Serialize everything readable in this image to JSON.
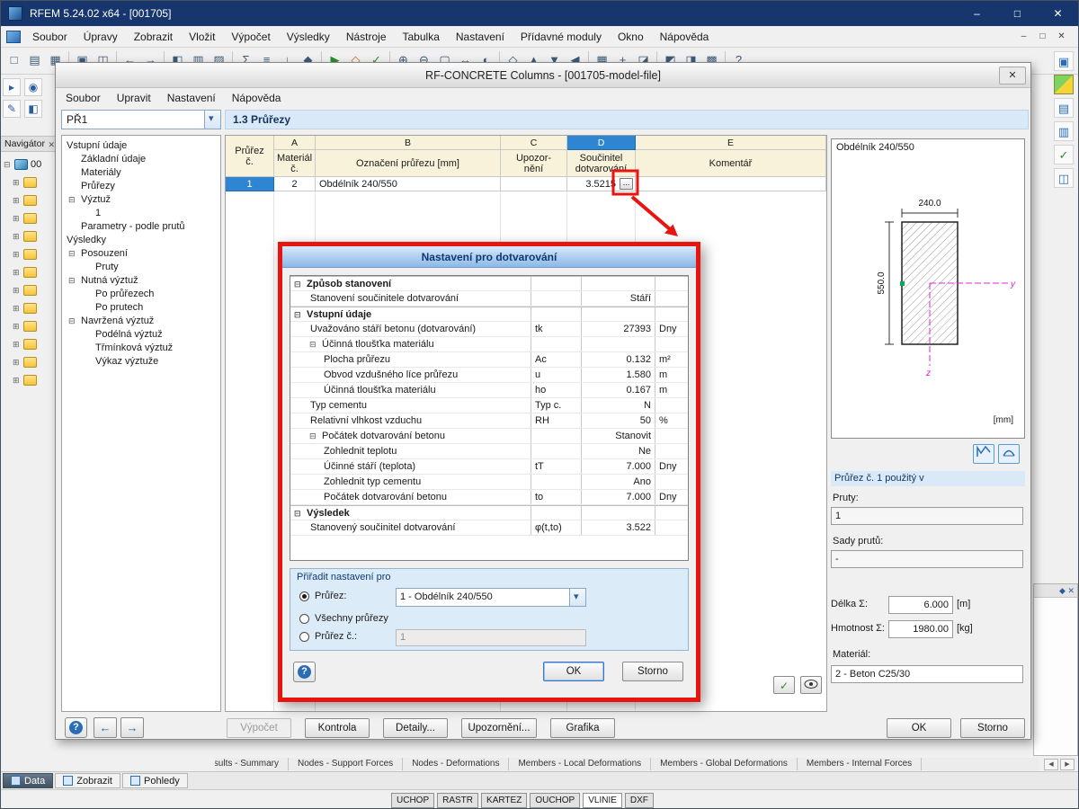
{
  "colors": {
    "accent_blue": "#2e86d2",
    "annotation_red": "#e81410",
    "titlebar_blue": "#17366e",
    "header_yellow": "#f8f2da",
    "panel_blue": "#d9e9f7"
  },
  "window": {
    "title": "RFEM 5.24.02 x64 - [001705]",
    "controls": {
      "minimize": "–",
      "maximize": "□",
      "close": "✕"
    },
    "mdi_controls": {
      "minimize": "–",
      "restore": "□",
      "close": "✕"
    },
    "menu": [
      {
        "label": "Soubor"
      },
      {
        "label": "Úpravy"
      },
      {
        "label": "Zobrazit"
      },
      {
        "label": "Vložit"
      },
      {
        "label": "Výpočet"
      },
      {
        "label": "Výsledky"
      },
      {
        "label": "Nástroje"
      },
      {
        "label": "Tabulka"
      },
      {
        "label": "Nastavení"
      },
      {
        "label": "Přídavné moduly"
      },
      {
        "label": "Okno"
      },
      {
        "label": "Nápověda"
      }
    ]
  },
  "toolbar": {
    "icons": [
      {
        "name": "new",
        "glyph": "□"
      },
      {
        "name": "open",
        "glyph": "▤"
      },
      {
        "name": "save",
        "glyph": "▦"
      },
      {
        "type": "sep"
      },
      {
        "name": "print",
        "glyph": "▣"
      },
      {
        "name": "print-preview",
        "glyph": "◫"
      },
      {
        "type": "sep"
      },
      {
        "name": "undo",
        "glyph": "←"
      },
      {
        "name": "redo",
        "glyph": "→"
      },
      {
        "type": "sep"
      },
      {
        "name": "navigator",
        "glyph": "◧"
      },
      {
        "name": "tables",
        "glyph": "▥"
      },
      {
        "name": "worksheet",
        "glyph": "▨"
      },
      {
        "type": "sep"
      },
      {
        "name": "load-cases",
        "glyph": "Σ"
      },
      {
        "name": "combinations",
        "glyph": "≡"
      },
      {
        "name": "loads",
        "glyph": "↓"
      },
      {
        "name": "imperfections",
        "glyph": "◆"
      },
      {
        "type": "sep"
      },
      {
        "name": "calculate",
        "glyph": "▶",
        "icon": "green"
      },
      {
        "name": "results",
        "glyph": "◇",
        "icon": "orange"
      },
      {
        "name": "check",
        "glyph": "✓",
        "icon": "green"
      },
      {
        "type": "sep"
      },
      {
        "name": "zoom-in",
        "glyph": "⊕"
      },
      {
        "name": "zoom-out",
        "glyph": "⊖"
      },
      {
        "name": "zoom-window",
        "glyph": "▢"
      },
      {
        "name": "pan",
        "glyph": "↔"
      },
      {
        "name": "orbit",
        "glyph": "◐"
      },
      {
        "type": "sep"
      },
      {
        "name": "view-iso",
        "glyph": "◇"
      },
      {
        "name": "view-x",
        "glyph": "▲"
      },
      {
        "name": "view-y",
        "glyph": "▼"
      },
      {
        "name": "view-z",
        "glyph": "◀"
      },
      {
        "type": "sep"
      },
      {
        "name": "grid",
        "glyph": "▦"
      },
      {
        "name": "snap",
        "glyph": "+"
      },
      {
        "name": "work-plane",
        "glyph": "◪"
      },
      {
        "type": "sep"
      },
      {
        "name": "render",
        "glyph": "◩"
      },
      {
        "name": "display",
        "glyph": "◨"
      },
      {
        "name": "modules",
        "glyph": "▩"
      },
      {
        "type": "sep"
      },
      {
        "name": "help",
        "glyph": "?"
      }
    ]
  },
  "right_toolbar": {
    "icons": [
      {
        "name": "print-view",
        "glyph": "▣"
      },
      {
        "name": "export-excel",
        "glyph": "",
        "icon": "colorgrid"
      },
      {
        "name": "input-tables",
        "glyph": "▤"
      },
      {
        "name": "result-tables",
        "glyph": "▥"
      },
      {
        "name": "check-model",
        "glyph": "✓",
        "icon": "green"
      },
      {
        "name": "panel-toggle",
        "glyph": "◫"
      }
    ]
  },
  "side_icons": [
    {
      "name": "select",
      "glyph": "▸"
    },
    {
      "name": "point",
      "glyph": "◉"
    },
    {
      "name": "edit",
      "glyph": "✎"
    },
    {
      "name": "views",
      "glyph": "◧"
    }
  ],
  "navigator": {
    "title": "Navigátor",
    "close": "✕",
    "tree": [
      {
        "box": "⊟",
        "icon": "model",
        "label": "00",
        "level": 0
      },
      {
        "box": "⊞",
        "icon": "folder",
        "label": "",
        "level": 1
      },
      {
        "box": "⊞",
        "icon": "folder",
        "label": "",
        "level": 1
      },
      {
        "box": "⊞",
        "icon": "folder",
        "label": "",
        "level": 1
      },
      {
        "box": "⊞",
        "icon": "folder",
        "label": "",
        "level": 1
      },
      {
        "box": "⊞",
        "icon": "folder",
        "label": "",
        "level": 1
      },
      {
        "box": "⊞",
        "icon": "folder",
        "label": "",
        "level": 1
      },
      {
        "box": "⊞",
        "icon": "folder",
        "label": "",
        "level": 1
      },
      {
        "box": "⊞",
        "icon": "folder",
        "label": "",
        "level": 1
      },
      {
        "box": "⊞",
        "icon": "folder",
        "label": "",
        "level": 1
      },
      {
        "box": "⊞",
        "icon": "folder",
        "label": "",
        "level": 1
      },
      {
        "box": "⊞",
        "icon": "folder",
        "label": "",
        "level": 1
      },
      {
        "box": "⊞",
        "icon": "folder",
        "label": "",
        "level": 1
      }
    ]
  },
  "module": {
    "title": "RF-CONCRETE Columns - [001705-model-file]",
    "close": "✕",
    "menu": [
      {
        "label": "Soubor"
      },
      {
        "label": "Upravit"
      },
      {
        "label": "Nastavení"
      },
      {
        "label": "Nápověda"
      }
    ],
    "case": "PŘ1",
    "section_title": "1.3 Průřezy",
    "tree": [
      {
        "label": "Vstupní údaje",
        "level": 0,
        "box": ""
      },
      {
        "label": "Základní údaje",
        "level": 1,
        "box": ""
      },
      {
        "label": "Materiály",
        "level": 1,
        "box": ""
      },
      {
        "label": "Průřezy",
        "level": 1,
        "box": ""
      },
      {
        "label": "Výztuž",
        "level": 1,
        "box": "⊟"
      },
      {
        "label": "1",
        "level": 2,
        "box": ""
      },
      {
        "label": "Parametry - podle prutů",
        "level": 1,
        "box": ""
      },
      {
        "label": "Výsledky",
        "level": 0,
        "box": ""
      },
      {
        "label": "Posouzení",
        "level": 1,
        "box": "⊟"
      },
      {
        "label": "Pruty",
        "level": 2,
        "box": ""
      },
      {
        "label": "Nutná výztuž",
        "level": 1,
        "box": "⊟"
      },
      {
        "label": "Po průřezech",
        "level": 2,
        "box": ""
      },
      {
        "label": "Po prutech",
        "level": 2,
        "box": ""
      },
      {
        "label": "Navržená výztuž",
        "level": 1,
        "box": "⊟"
      },
      {
        "label": "Podélná výztuž",
        "level": 2,
        "box": ""
      },
      {
        "label": "Třmínková výztuž",
        "level": 2,
        "box": ""
      },
      {
        "label": "Výkaz výztuže",
        "level": 2,
        "box": ""
      }
    ],
    "table": {
      "letters": [
        "A",
        "B",
        "C",
        "D",
        "E"
      ],
      "headers": {
        "rownum1": "Průřez",
        "rownum2": "č.",
        "a1": "Materiál",
        "a2": "č.",
        "b": "Označení průřezu [mm]",
        "c1": "Upozor-",
        "c2": "nění",
        "d1": "Součinitel",
        "d2": "dotvarování",
        "e": "Komentář"
      },
      "row": {
        "num": "1",
        "mat": "2",
        "name": "Obdélník 240/550",
        "warn": "",
        "creep": "3.5215",
        "more": "...",
        "comment": ""
      }
    },
    "preview": {
      "caption": "Obdélník 240/550",
      "dim_w": "240.0",
      "dim_h": "550.0",
      "axis_y": "y",
      "axis_z": "z",
      "unit": "[mm]"
    },
    "usage": {
      "title": "Průřez č. 1 použitý v",
      "pruty_label": "Pruty:",
      "pruty": "1",
      "sady_label": "Sady prutů:",
      "sady": "-",
      "delka_label": "Délka Σ:",
      "delka": "6.000",
      "delka_unit": "[m]",
      "hmotnost_label": "Hmotnost Σ:",
      "hmotnost": "1980.00",
      "hmotnost_unit": "[kg]",
      "material_label": "Materiál:",
      "material": "2 - Beton C25/30"
    },
    "buttons": {
      "vypocet": "Výpočet",
      "kontrola": "Kontrola",
      "detaily": "Detaily...",
      "upozorneni": "Upozornění...",
      "grafika": "Grafika",
      "ok": "OK",
      "storno": "Storno"
    }
  },
  "creep": {
    "title": "Nastavení pro dotvarování",
    "rows": [
      {
        "type": "section",
        "level": 0,
        "box": "⊟",
        "label": "Způsob stanovení",
        "sym": "",
        "val": "",
        "unit": ""
      },
      {
        "type": "item",
        "level": 1,
        "box": "",
        "label": "Stanovení součinitele dotvarování",
        "sym": "",
        "val": "Stáří",
        "unit": ""
      },
      {
        "type": "section",
        "level": 0,
        "box": "⊟",
        "label": "Vstupní údaje",
        "sym": "",
        "val": "",
        "unit": ""
      },
      {
        "type": "item",
        "level": 1,
        "box": "",
        "label": "Uvažováno stáří betonu (dotvarování)",
        "sym": "tk",
        "val": "27393",
        "unit": "Dny"
      },
      {
        "type": "subsection",
        "level": 1,
        "box": "⊟",
        "label": "Účinná tloušťka materiálu",
        "sym": "",
        "val": "",
        "unit": ""
      },
      {
        "type": "item",
        "level": 2,
        "box": "",
        "label": "Plocha průřezu",
        "sym": "Ac",
        "val": "0.132",
        "unit": "m²"
      },
      {
        "type": "item",
        "level": 2,
        "box": "",
        "label": "Obvod vzdušného líce průřezu",
        "sym": "u",
        "val": "1.580",
        "unit": "m"
      },
      {
        "type": "item",
        "level": 2,
        "box": "",
        "label": "Účinná tloušťka materiálu",
        "sym": "ho",
        "val": "0.167",
        "unit": "m"
      },
      {
        "type": "item",
        "level": 1,
        "box": "",
        "label": "Typ cementu",
        "sym": "Typ c.",
        "val": "N",
        "unit": ""
      },
      {
        "type": "item",
        "level": 1,
        "box": "",
        "label": "Relativní vlhkost vzduchu",
        "sym": "RH",
        "val": "50",
        "unit": "%"
      },
      {
        "type": "subsection",
        "level": 1,
        "box": "⊟",
        "label": "Počátek dotvarování betonu",
        "sym": "",
        "val": "Stanovit",
        "unit": ""
      },
      {
        "type": "item",
        "level": 2,
        "box": "",
        "label": "Zohlednit teplotu",
        "sym": "",
        "val": "Ne",
        "unit": ""
      },
      {
        "type": "item",
        "level": 2,
        "box": "",
        "label": "Účinné stáří (teplota)",
        "sym": "tT",
        "val": "7.000",
        "unit": "Dny"
      },
      {
        "type": "item",
        "level": 2,
        "box": "",
        "label": "Zohlednit typ cementu",
        "sym": "",
        "val": "Ano",
        "unit": ""
      },
      {
        "type": "item",
        "level": 2,
        "box": "",
        "label": "Počátek dotvarování betonu",
        "sym": "to",
        "val": "7.000",
        "unit": "Dny"
      },
      {
        "type": "section",
        "level": 0,
        "box": "⊟",
        "label": "Výsledek",
        "sym": "",
        "val": "",
        "unit": ""
      },
      {
        "type": "item",
        "level": 1,
        "box": "",
        "label": "Stanovený součinitel dotvarování",
        "sym": "φ(t,to)",
        "val": "3.522",
        "unit": ""
      }
    ],
    "assign": {
      "title": "Přiřadit nastavení pro",
      "opt1": "Průřez:",
      "opt1_value": "1 - Obdélník 240/550",
      "opt2": "Všechny průřezy",
      "opt3": "Průřez č.:",
      "opt3_value": "1"
    },
    "ok": "OK",
    "cancel": "Storno"
  },
  "results_tabs": [
    {
      "label": "Results - Summary"
    },
    {
      "label": "Nodes - Support Forces"
    },
    {
      "label": "Nodes - Deformations"
    },
    {
      "label": "Members - Local Deformations"
    },
    {
      "label": "Members - Global Deformations"
    },
    {
      "label": "Members - Internal Forces"
    }
  ],
  "bottom_tabs": [
    {
      "label": "Data",
      "selected": true
    },
    {
      "label": "Zobrazit"
    },
    {
      "label": "Pohledy"
    }
  ],
  "statusbar": [
    {
      "label": "UCHOP"
    },
    {
      "label": "RASTR"
    },
    {
      "label": "KARTEZ"
    },
    {
      "label": "OUCHOP"
    },
    {
      "label": "VLINIE",
      "active": true
    },
    {
      "label": "DXF"
    }
  ]
}
